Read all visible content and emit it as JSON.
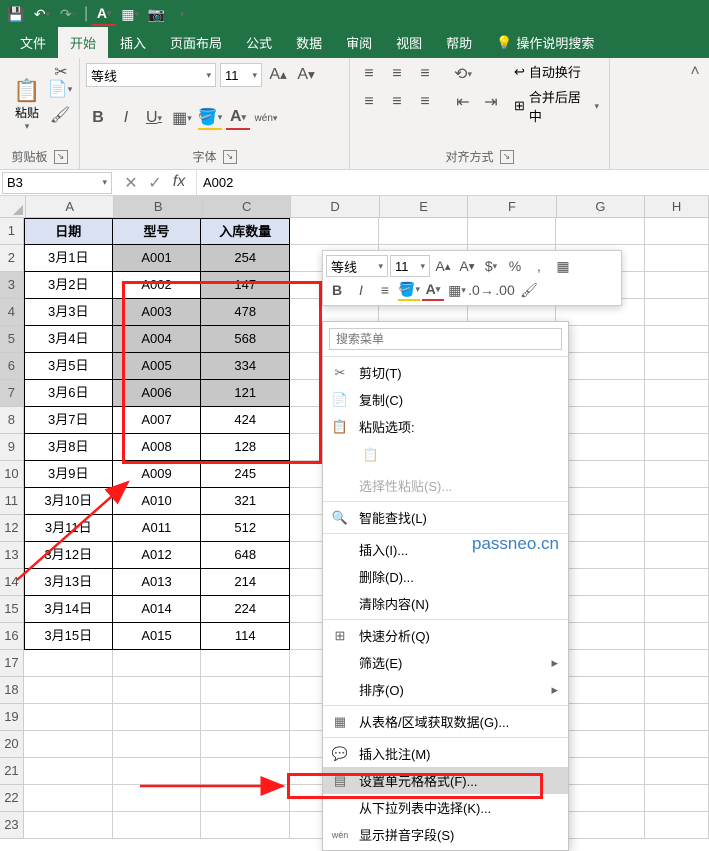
{
  "qat": [
    "💾",
    "↶",
    "↷"
  ],
  "tabs": {
    "items": [
      "文件",
      "开始",
      "插入",
      "页面布局",
      "公式",
      "数据",
      "审阅",
      "视图",
      "帮助"
    ],
    "active": 1,
    "tell": "操作说明搜索"
  },
  "ribbon": {
    "clipboard": {
      "paste": "粘贴",
      "label": "剪贴板"
    },
    "font": {
      "name": "等线",
      "size": "11",
      "label": "字体"
    },
    "align": {
      "wrap": "自动换行",
      "merge": "合并后居中",
      "label": "对齐方式"
    }
  },
  "namebox": "B3",
  "formula": "A002",
  "cols": [
    "A",
    "B",
    "C",
    "D",
    "E",
    "F",
    "G",
    "H"
  ],
  "header": [
    "日期",
    "型号",
    "入库数量"
  ],
  "rows": [
    [
      "3月1日",
      "A001",
      "254"
    ],
    [
      "3月2日",
      "A002",
      "147"
    ],
    [
      "3月3日",
      "A003",
      "478"
    ],
    [
      "3月4日",
      "A004",
      "568"
    ],
    [
      "3月5日",
      "A005",
      "334"
    ],
    [
      "3月6日",
      "A006",
      "121"
    ],
    [
      "3月7日",
      "A007",
      "424"
    ],
    [
      "3月8日",
      "A008",
      "128"
    ],
    [
      "3月9日",
      "A009",
      "245"
    ],
    [
      "3月10日",
      "A010",
      "321"
    ],
    [
      "3月11日",
      "A011",
      "512"
    ],
    [
      "3月12日",
      "A012",
      "648"
    ],
    [
      "3月13日",
      "A013",
      "214"
    ],
    [
      "3月14日",
      "A014",
      "224"
    ],
    [
      "3月15日",
      "A015",
      "114"
    ]
  ],
  "mini": {
    "font": "等线",
    "size": "11"
  },
  "ctx": {
    "search": "搜索菜单",
    "cut": "剪切(T)",
    "copy": "复制(C)",
    "pasteopt": "粘贴选项:",
    "pastespecial": "选择性粘贴(S)...",
    "smartlookup": "智能查找(L)",
    "insert": "插入(I)...",
    "delete": "删除(D)...",
    "clear": "清除内容(N)",
    "quick": "快速分析(Q)",
    "filter": "筛选(E)",
    "sort": "排序(O)",
    "fromtable": "从表格/区域获取数据(G)...",
    "comment": "插入批注(M)",
    "format": "设置单元格格式(F)...",
    "dropdown": "从下拉列表中选择(K)...",
    "phonetic": "显示拼音字段(S)"
  },
  "watermark": "passneo.cn"
}
